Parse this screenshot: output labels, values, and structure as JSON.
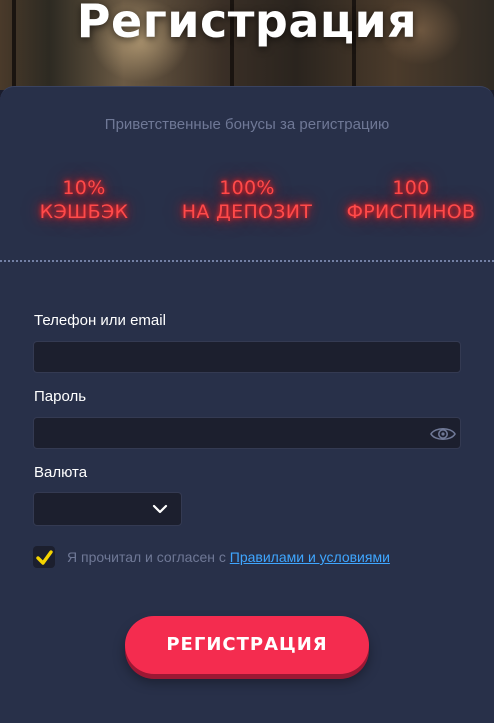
{
  "header": {
    "title": "Регистрация"
  },
  "bonuses": {
    "heading": "Приветственные бонусы за регистрацию",
    "items": [
      {
        "line1": "10%",
        "line2": "КЭШБЭК"
      },
      {
        "line1": "100%",
        "line2": "НА ДЕПОЗИТ"
      },
      {
        "line1": "100",
        "line2": "ФРИСПИНОВ"
      }
    ],
    "glow_color": "#ff3030"
  },
  "form": {
    "phone_label": "Телефон или email",
    "phone_value": "",
    "password_label": "Пароль",
    "password_value": "",
    "password_toggle_icon": "eye-icon",
    "currency_label": "Валюта",
    "currency_value": "",
    "agree_checked": true,
    "agree_text": "Я прочитал и согласен с ",
    "agree_link": "Правилами и условиями",
    "submit_label": "РЕГИСТРАЦИЯ"
  },
  "colors": {
    "card_bg": "#283049",
    "accent": "#f42c4f",
    "link": "#3fa6ff",
    "checkbox_mark": "#f5d400"
  }
}
